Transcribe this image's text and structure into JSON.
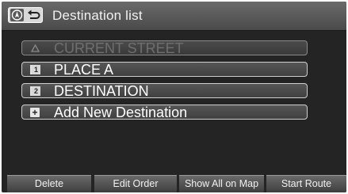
{
  "header": {
    "title": "Destination list"
  },
  "icons": {
    "nav": "navigation-arrow-icon",
    "back": "back-return-icon"
  },
  "list": {
    "items": [
      {
        "label": "CURRENT STREET",
        "icon": "triangle-icon",
        "badge": "",
        "disabled": true
      },
      {
        "label": "PLACE A",
        "icon": "waypoint-number-icon",
        "badge": "1",
        "disabled": false
      },
      {
        "label": "DESTINATION",
        "icon": "waypoint-number-icon",
        "badge": "2",
        "disabled": false
      },
      {
        "label": "Add New Destination",
        "icon": "plus-icon",
        "badge": "+",
        "disabled": false
      }
    ]
  },
  "buttons": {
    "delete": "Delete",
    "edit_order": "Edit Order",
    "show_all": "Show All on Map",
    "start_route": "Start Route"
  },
  "colors": {
    "background": "#242424",
    "item_border": "#cfcfcf",
    "disabled_text": "#6f6f6f"
  }
}
